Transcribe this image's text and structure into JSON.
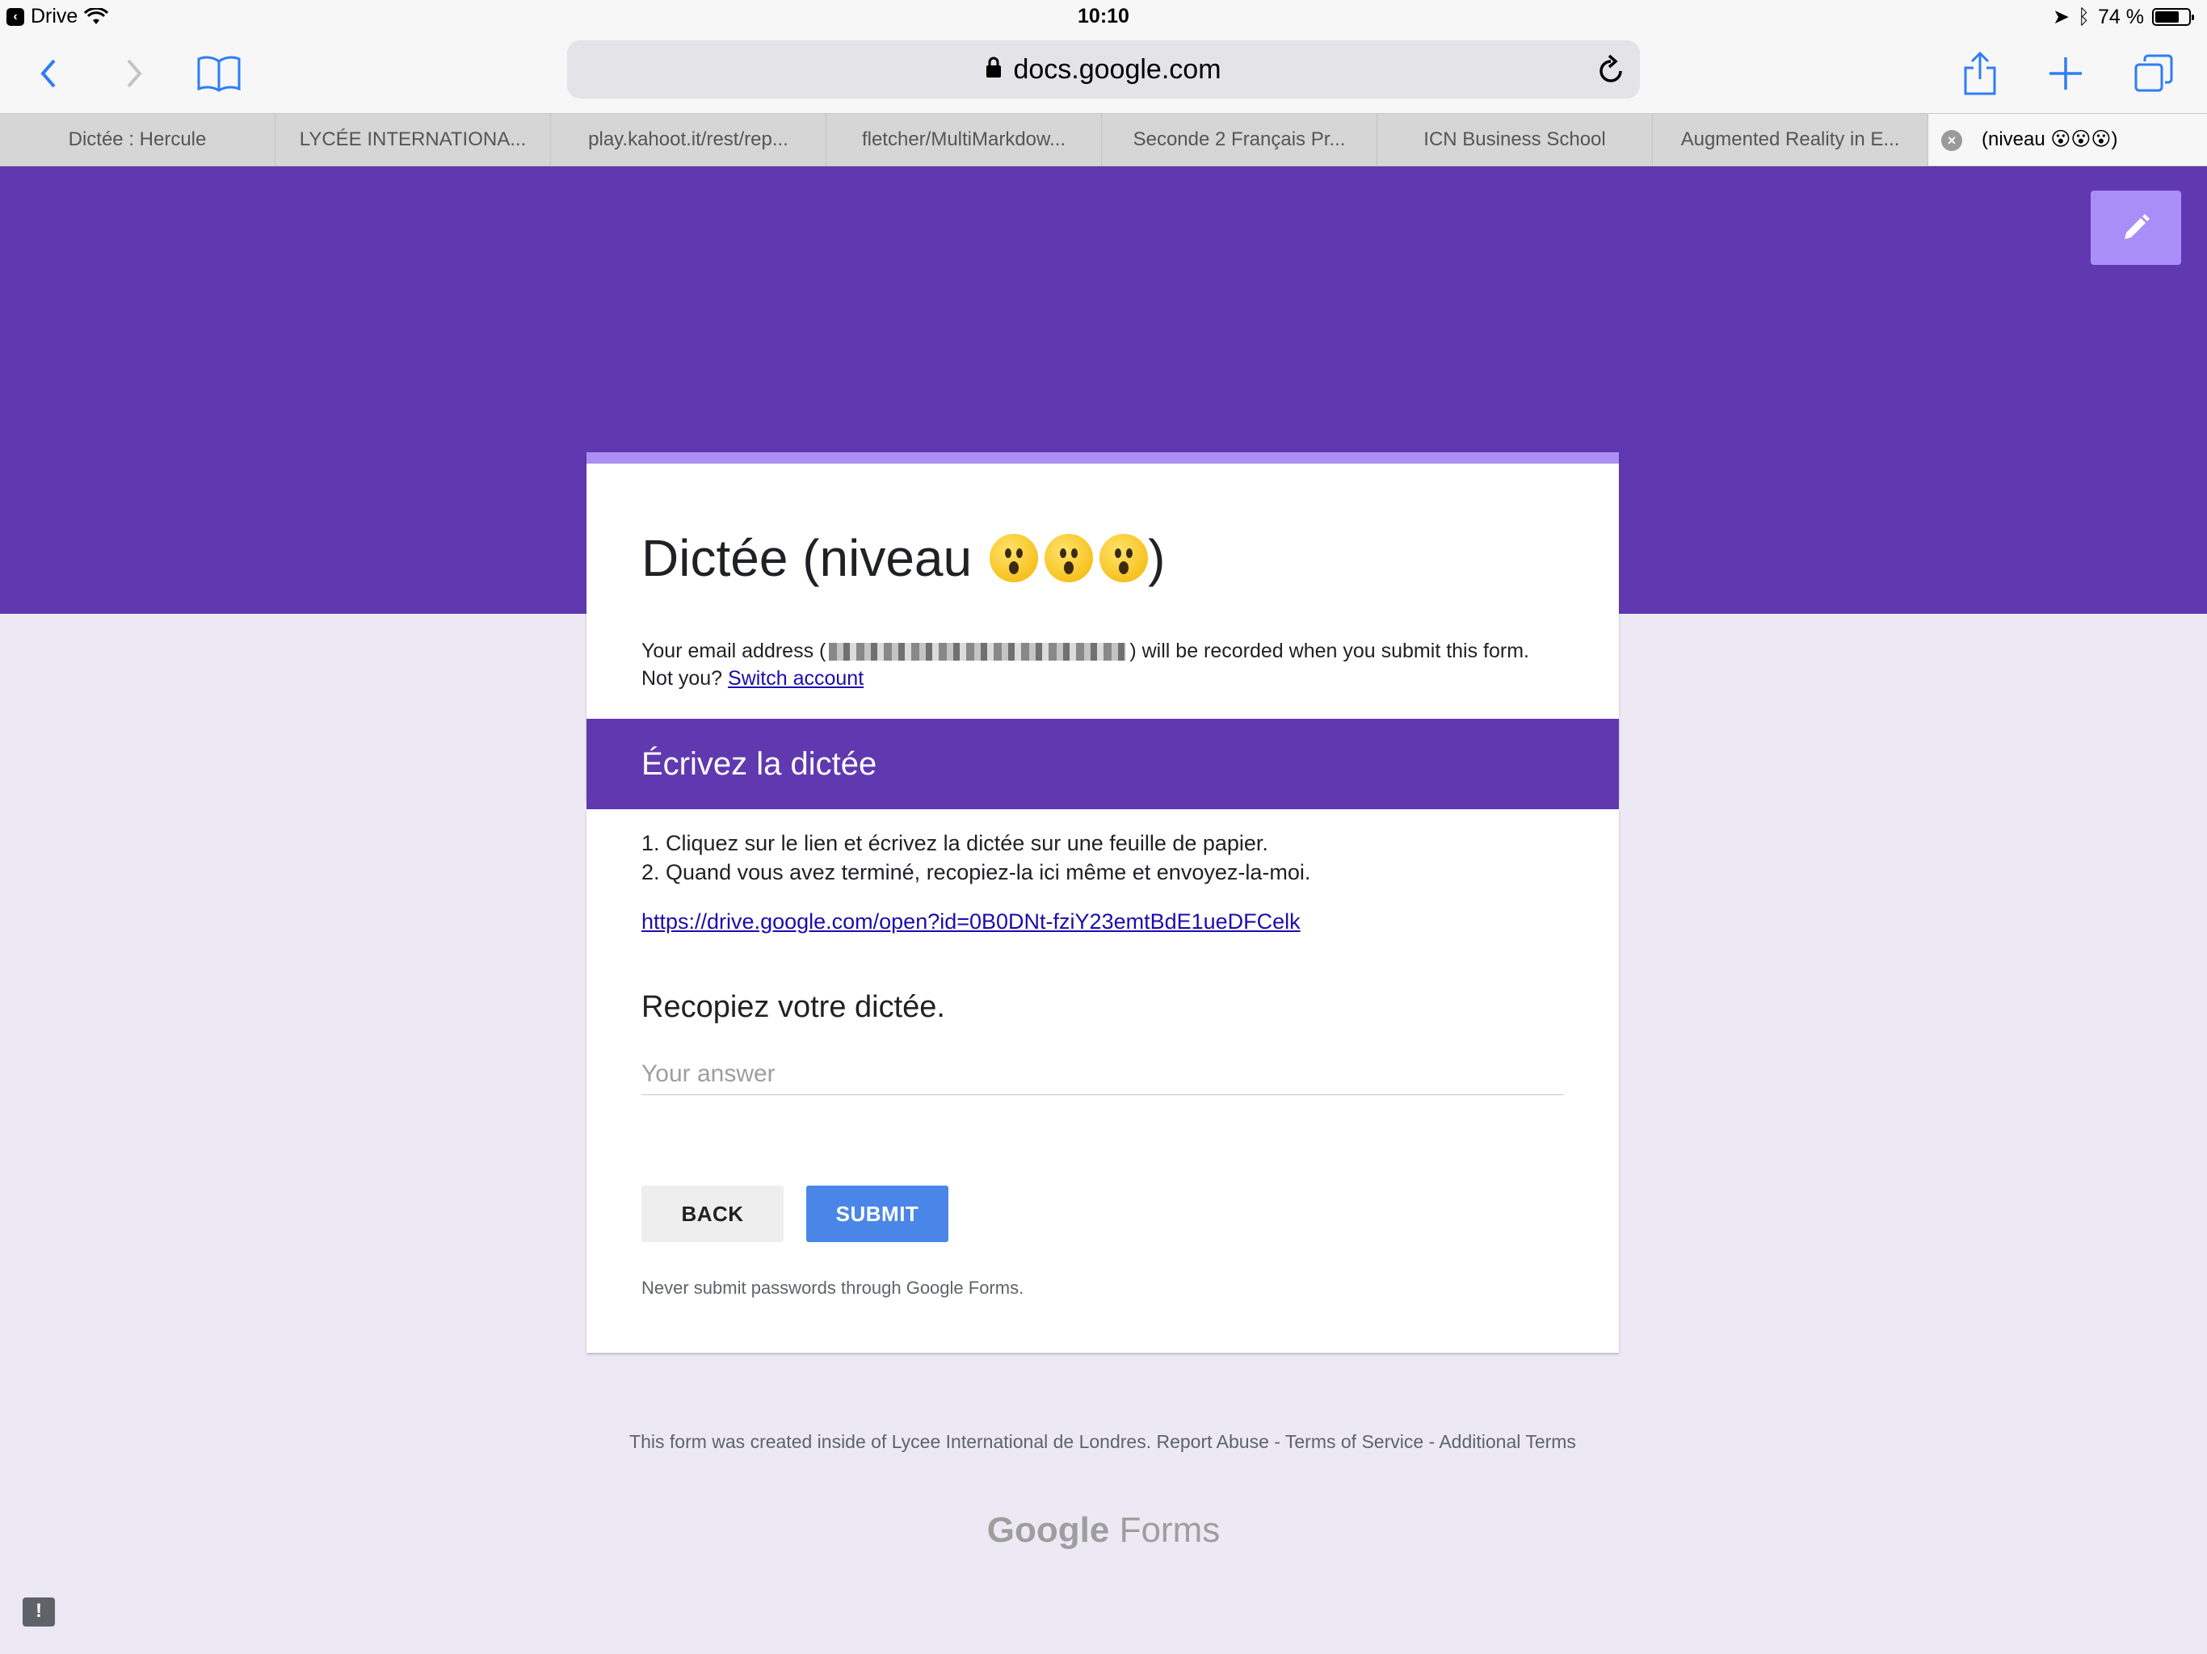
{
  "status_bar": {
    "back_app": "Drive",
    "time": "10:10",
    "battery_percent": "74 %",
    "battery_level": 0.74
  },
  "toolbar": {
    "url": "docs.google.com",
    "icons": [
      "back-icon",
      "forward-icon",
      "bookmarks-icon",
      "lock-icon",
      "reload-icon",
      "share-icon",
      "new-tab-icon",
      "tabs-icon"
    ]
  },
  "tabs": [
    {
      "label": "Dictée : Hercule"
    },
    {
      "label": "LYCÉE INTERNATIONA..."
    },
    {
      "label": "play.kahoot.it/rest/rep..."
    },
    {
      "label": "fletcher/MultiMarkdow..."
    },
    {
      "label": "Seconde 2 Français Pr..."
    },
    {
      "label": "ICN Business School"
    },
    {
      "label": "Augmented Reality in E..."
    },
    {
      "label": "(niveau 😮😮😮)"
    }
  ],
  "form": {
    "title_prefix": "Dictée (niveau",
    "title_suffix": ")",
    "email_prefix": "Your email address (",
    "email_suffix": ") will be recorded when you submit this form. Not you?",
    "switch_account": "Switch account",
    "section_title": "Écrivez la dictée",
    "instruction_1": "1. Cliquez sur le lien et écrivez la dictée sur une feuille de papier.",
    "instruction_2": "2. Quand vous avez terminé, recopiez-la ici même et envoyez-la-moi.",
    "drive_link": "https://drive.google.com/open?id=0B0DNt-fziY23emtBdE1ueDFCelk",
    "question": "Recopiez votre dictée.",
    "answer_placeholder": "Your answer",
    "back_label": "BACK",
    "submit_label": "SUBMIT",
    "password_warning": "Never submit passwords through Google Forms."
  },
  "footer": {
    "text": "This form was created inside of Lycee International de Londres. Report Abuse - Terms of Service - Additional Terms",
    "brand_google": "Google",
    "brand_forms": "Forms"
  },
  "colors": {
    "theme": "#6039b1",
    "accent": "#ab8ff2",
    "submit": "#4a86e8",
    "background": "#ece9f5"
  }
}
